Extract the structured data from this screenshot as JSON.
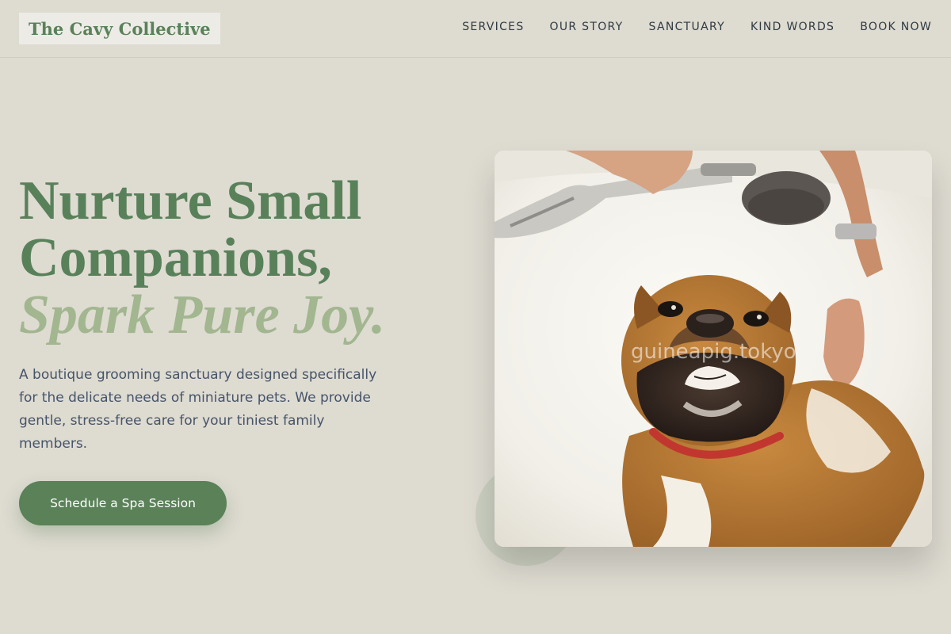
{
  "brand": {
    "name": "The Cavy Collective"
  },
  "nav": {
    "items": [
      {
        "label": "SERVICES"
      },
      {
        "label": "OUR STORY"
      },
      {
        "label": "SANCTUARY"
      },
      {
        "label": "KIND WORDS"
      },
      {
        "label": "BOOK NOW"
      }
    ]
  },
  "hero": {
    "title_line1": "Nurture Small",
    "title_line2": "Companions,",
    "title_accent": "Spark Pure Joy.",
    "description": "A boutique grooming sanctuary designed specifically for the delicate needs of miniature pets. We provide gentle, stress-free care for your tiniest family members.",
    "cta_label": "Schedule a Spa Session"
  },
  "image": {
    "watermark": "guineapig.tokyo"
  },
  "colors": {
    "accent": "#5a8158",
    "accent_light": "#a2b690",
    "background": "#dedbd1"
  }
}
